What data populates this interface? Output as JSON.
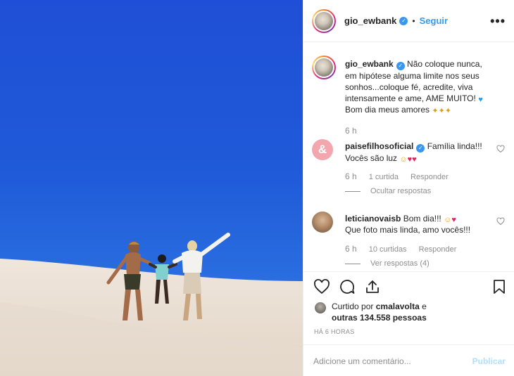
{
  "post": {
    "username": "gio_ewbank",
    "separator": "•",
    "follow_label": "Seguir",
    "more_label": "•••"
  },
  "caption": {
    "username": "gio_ewbank",
    "text": "Não coloque nunca, em hipótese alguma limite nos seus sonhos...coloque fé, acredite, viva intensamente e ame, AME MUITO!",
    "text2": "Bom dia meus amores",
    "time": "6 h"
  },
  "comments": [
    {
      "username": "paisefilhosoficial",
      "text": "Família linda!!! Vocês são luz",
      "time": "6 h",
      "likes": "1 curtida",
      "reply": "Responder",
      "replies_toggle": "Ocultar respostas"
    },
    {
      "username": "leticianovaisb",
      "text": "Bom dia!!!",
      "text2": "Que foto mais linda, amo vocês!!!",
      "time": "6 h",
      "likes": "10 curtidas",
      "reply": "Responder",
      "replies_toggle": "Ver respostas (4)"
    }
  ],
  "likes": {
    "prefix": "Curtido por",
    "user": "cmalavolta",
    "joiner": "e",
    "others": "outras 134.558 pessoas"
  },
  "timestamp": "HÁ 6 HORAS",
  "add_comment": {
    "placeholder": "Adicione um comentário...",
    "publish": "Publicar"
  },
  "icons": [
    "heart-icon",
    "comment-icon",
    "share-icon",
    "bookmark-icon",
    "verified-icon",
    "more-icon"
  ],
  "colors": {
    "link": "#3897f0",
    "muted": "#8e8e8e",
    "publish_disabled": "#b2dffc"
  }
}
